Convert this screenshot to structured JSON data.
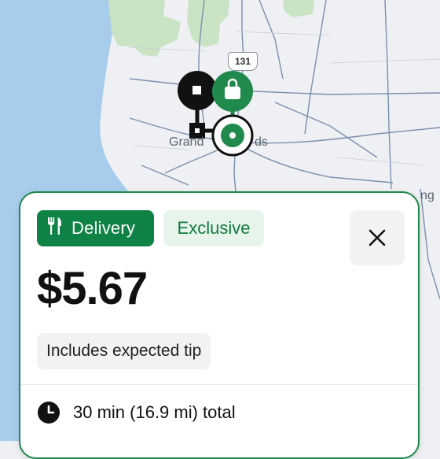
{
  "map": {
    "city_label_left": "Grand",
    "city_label_right": "ds",
    "highway_shield": "131",
    "edge_label": "ng",
    "colors": {
      "water": "#a8cdec",
      "land": "#eef0f3",
      "park": "#c9e3c4",
      "road": "#7b8fb0",
      "route": "#111111",
      "accent": "#1f8a4c"
    }
  },
  "card": {
    "delivery_label": "Delivery",
    "delivery_icon": "fork-knife-icon",
    "exclusive_label": "Exclusive",
    "close_icon": "close-icon",
    "price": "$5.67",
    "tip_note": "Includes expected tip",
    "duration_icon": "clock-icon",
    "duration_text": "30 min (16.9 mi) total"
  }
}
